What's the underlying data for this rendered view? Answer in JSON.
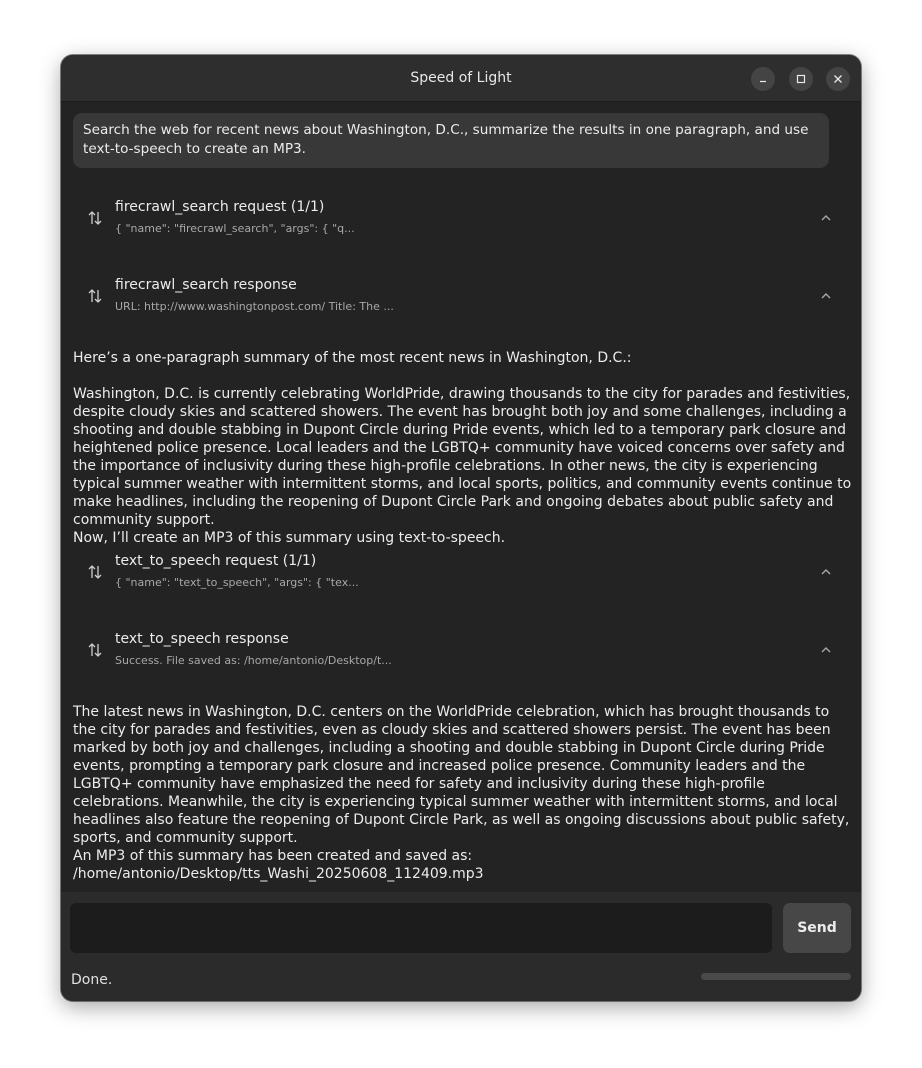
{
  "window": {
    "title": "Speed of Light",
    "controls": [
      "minimize-icon",
      "maximize-icon",
      "close-icon"
    ]
  },
  "prompt": {
    "text": "Search the web for recent news about Washington, D.C., summarize the results in one paragraph, and use text-to-speech to create an MP3."
  },
  "tool_calls": [
    {
      "title": "firecrawl_search request (1/1)",
      "preview": "{  \"name\": \"firecrawl_search\",  \"args\": {    \"q...",
      "icon": "swap-icon",
      "chevron": "chevron-up-icon"
    },
    {
      "title": "firecrawl_search response",
      "preview": "URL: http://www.washingtonpost.com/ Title: The ...",
      "icon": "swap-icon",
      "chevron": "chevron-up-icon"
    },
    {
      "title": "text_to_speech request (1/1)",
      "preview": "{  \"name\": \"text_to_speech\",  \"args\": {    \"tex...",
      "icon": "swap-icon",
      "chevron": "chevron-up-icon"
    },
    {
      "title": "text_to_speech response",
      "preview": "Success. File saved as: /home/antonio/Desktop/t...",
      "icon": "swap-icon",
      "chevron": "chevron-up-icon"
    }
  ],
  "messages": {
    "intro": "Here’s a one-paragraph summary of the most recent news in Washington, D.C.:",
    "summary": "Washington, D.C. is currently celebrating WorldPride, drawing thousands to the city for parades and festivities, despite cloudy skies and scattered showers. The event has brought both joy and some challenges, including a shooting and double stabbing in Dupont Circle during Pride events, which led to a temporary park closure and heightened police presence. Local leaders and the LGBTQ+ community have voiced concerns over safety and the importance of inclusivity during these high-profile celebrations. In other news, the city is experiencing typical summer weather with intermittent storms, and local sports, politics, and community events continue to make headlines, including the reopening of Dupont Circle Park and ongoing debates about public safety and community support.",
    "mp3_intent": "Now, I’ll create an MP3 of this summary using text-to-speech.",
    "final_summary": "The latest news in Washington, D.C. centers on the WorldPride celebration, which has brought thousands to the city for parades and festivities, even as cloudy skies and scattered showers persist. The event has been marked by both joy and challenges, including a shooting and double stabbing in Dupont Circle during Pride events, prompting a temporary park closure and increased police presence. Community leaders and the LGBTQ+ community have emphasized the need for safety and inclusivity during these high-profile celebrations. Meanwhile, the city is experiencing typical summer weather with intermittent storms, and local headlines also feature the reopening of Dupont Circle Park, as well as ongoing discussions about public safety, sports, and community support.",
    "saved_line": "An MP3 of this summary has been created and saved as:",
    "saved_path": "/home/antonio/Desktop/tts_Washi_20250608_112409.mp3"
  },
  "composer": {
    "input_value": "",
    "send_label": "Send"
  },
  "status": {
    "text": "Done.",
    "progress": 0
  },
  "colors": {
    "window_bg": "#232323",
    "titlebar_bg": "#2e2e2e",
    "prompt_bg": "#383838",
    "send_bg": "#474747",
    "accent": "#3584e4"
  }
}
